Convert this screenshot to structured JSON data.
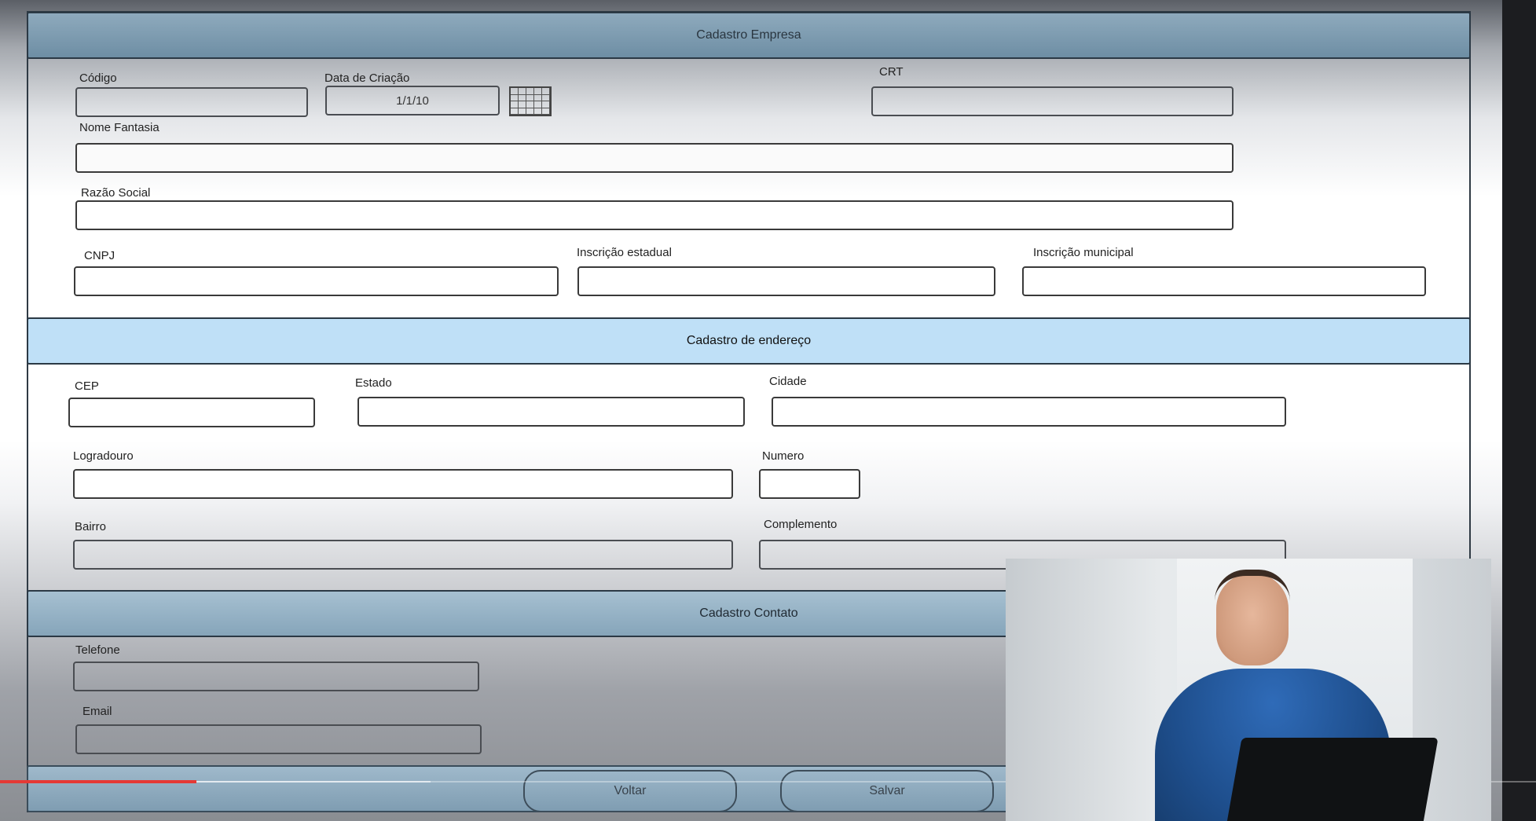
{
  "sections": {
    "empresa": "Cadastro Empresa",
    "endereco": "Cadastro de endereço",
    "contato": "Cadastro Contato"
  },
  "empresa": {
    "codigo_label": "Código",
    "data_label": "Data de Criação",
    "data_value": "1/1/10",
    "crt_label": "CRT",
    "nome_fantasia_label": "Nome Fantasia",
    "razao_social_label": "Razão Social",
    "cnpj_label": "CNPJ",
    "inscricao_estadual_label": "Inscrição estadual",
    "inscricao_municipal_label": "Inscrição municipal"
  },
  "endereco": {
    "cep_label": "CEP",
    "estado_label": "Estado",
    "cidade_label": "Cidade",
    "logradouro_label": "Logradouro",
    "numero_label": "Numero",
    "bairro_label": "Bairro",
    "complemento_label": "Complemento"
  },
  "contato": {
    "telefone_label": "Telefone",
    "email_label": "Email"
  },
  "actions": {
    "voltar": "Voltar",
    "salvar": "Salvar"
  },
  "video": {
    "progress_fraction": 0.128,
    "accent": "#e53935"
  }
}
